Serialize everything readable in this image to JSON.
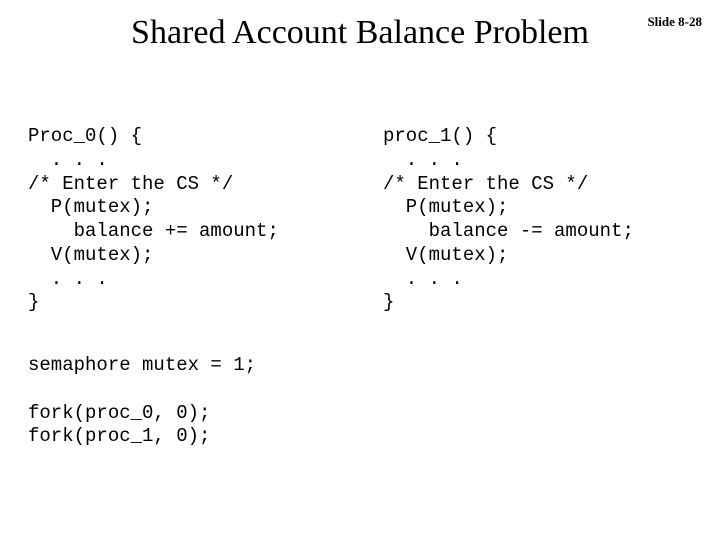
{
  "slide": {
    "number": "Slide 8-28",
    "title": "Shared Account Balance Problem"
  },
  "code": {
    "left": "Proc_0() {\n  . . .\n/* Enter the CS */\n  P(mutex);\n    balance += amount;\n  V(mutex);\n  . . .\n}",
    "right": "proc_1() {\n  . . .\n/* Enter the CS */\n  P(mutex);\n    balance -= amount;\n  V(mutex);\n  . . .\n}",
    "bottom": "semaphore mutex = 1;\n\nfork(proc_0, 0);\nfork(proc_1, 0);"
  }
}
